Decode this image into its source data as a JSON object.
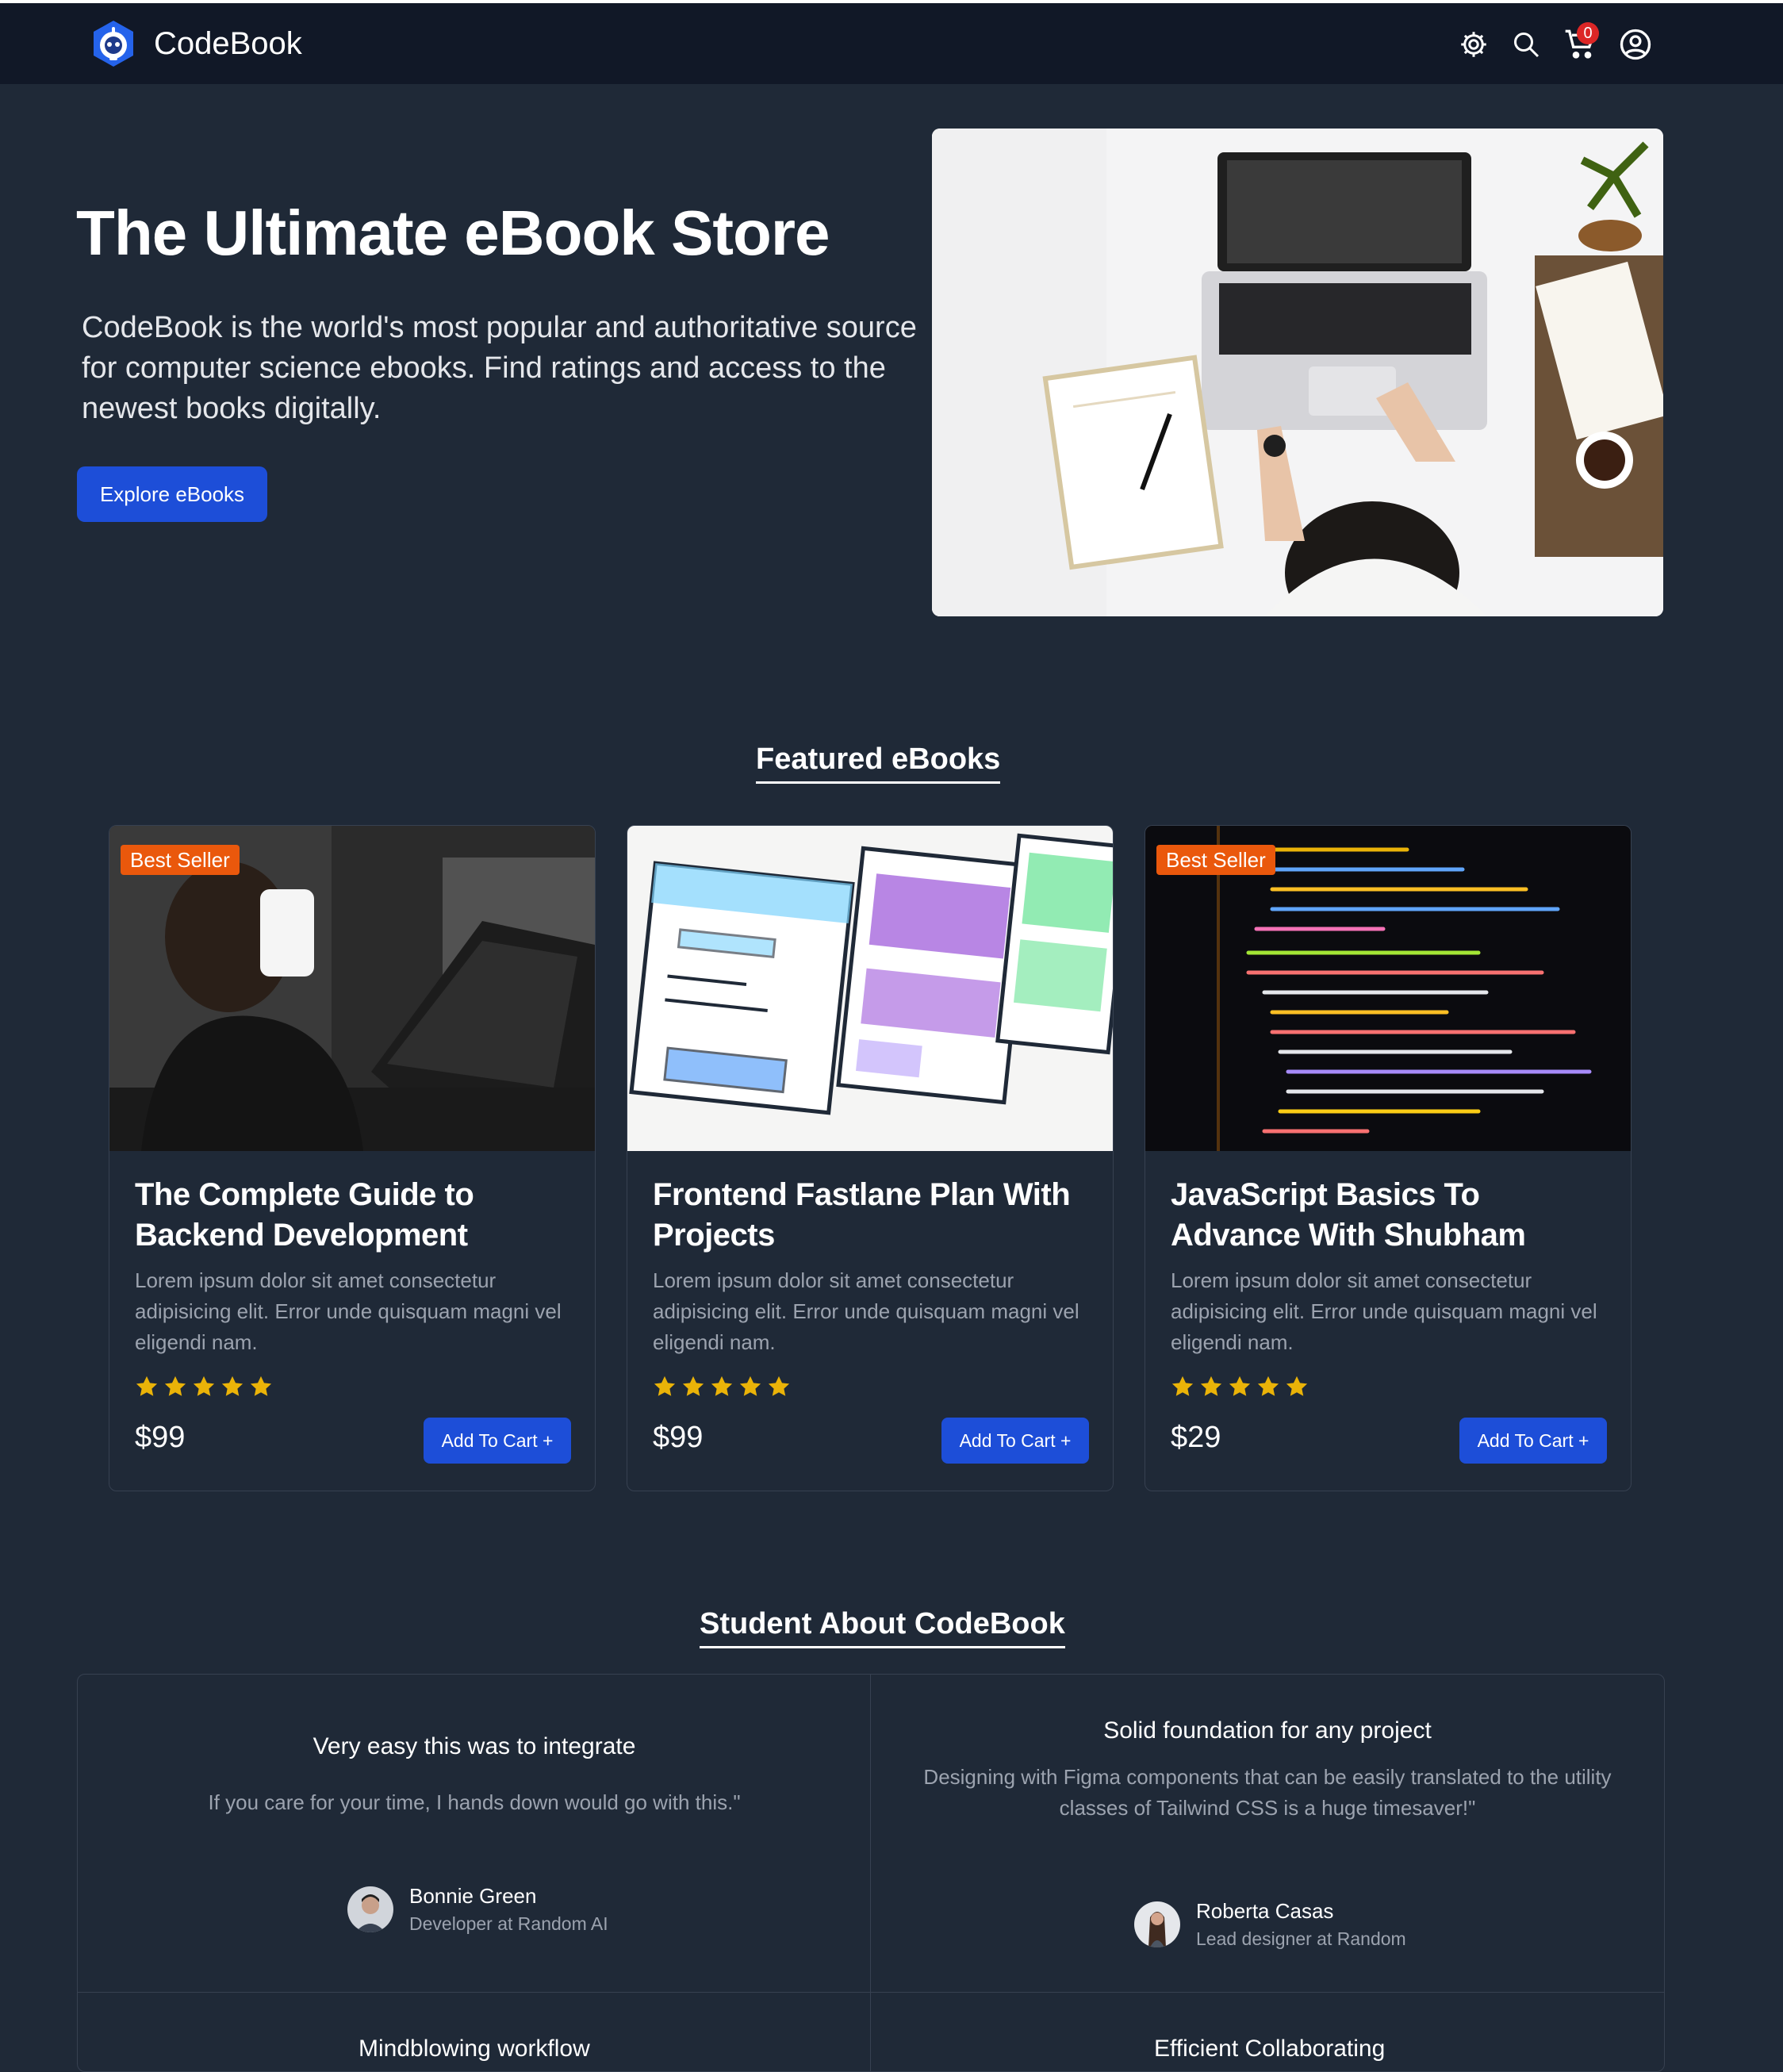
{
  "nav": {
    "brand": "CodeBook",
    "cart_count": "0",
    "icons": [
      "gear-icon",
      "search-icon",
      "cart-icon",
      "user-icon"
    ]
  },
  "hero": {
    "title": "The Ultimate eBook Store",
    "description": "CodeBook is the world's most popular and authoritative source for computer science ebooks. Find ratings and access to the newest books digitally.",
    "button": "Explore eBooks"
  },
  "featured": {
    "heading": "Featured eBooks",
    "cards": [
      {
        "badge": "Best Seller",
        "title": "The Complete Guide to Backend Development",
        "description": "Lorem ipsum dolor sit amet consectetur adipisicing elit. Error unde quisquam magni vel eligendi nam.",
        "rating": 5,
        "price": "$99",
        "button": "Add To Cart +"
      },
      {
        "badge": "",
        "title": "Frontend Fastlane Plan With Projects",
        "description": "Lorem ipsum dolor sit amet consectetur adipisicing elit. Error unde quisquam magni vel eligendi nam.",
        "rating": 5,
        "price": "$99",
        "button": "Add To Cart +"
      },
      {
        "badge": "Best Seller",
        "title": "JavaScript Basics To Advance With Shubham",
        "description": "Lorem ipsum dolor sit amet consectetur adipisicing elit. Error unde quisquam magni vel eligendi nam.",
        "rating": 5,
        "price": "$29",
        "button": "Add To Cart +"
      }
    ]
  },
  "testimonials": {
    "heading": "Student About CodeBook",
    "items": [
      {
        "title": "Very easy this was to integrate",
        "quote": "If you care for your time, I hands down would go with this.\"",
        "name": "Bonnie Green",
        "role": "Developer at Random AI"
      },
      {
        "title": "Solid foundation for any project",
        "quote": "Designing with Figma components that can be easily translated to the utility classes of Tailwind CSS is a huge timesaver!\"",
        "name": "Roberta Casas",
        "role": "Lead designer at Random"
      },
      {
        "title": "Mindblowing workflow"
      },
      {
        "title": "Efficient Collaborating"
      }
    ]
  },
  "colors": {
    "background": "#1f2937",
    "navbar": "#111827",
    "primary_button": "#1d4ed8",
    "badge": "#ea580c",
    "star": "#eab308",
    "cart_badge": "#dc2626"
  }
}
